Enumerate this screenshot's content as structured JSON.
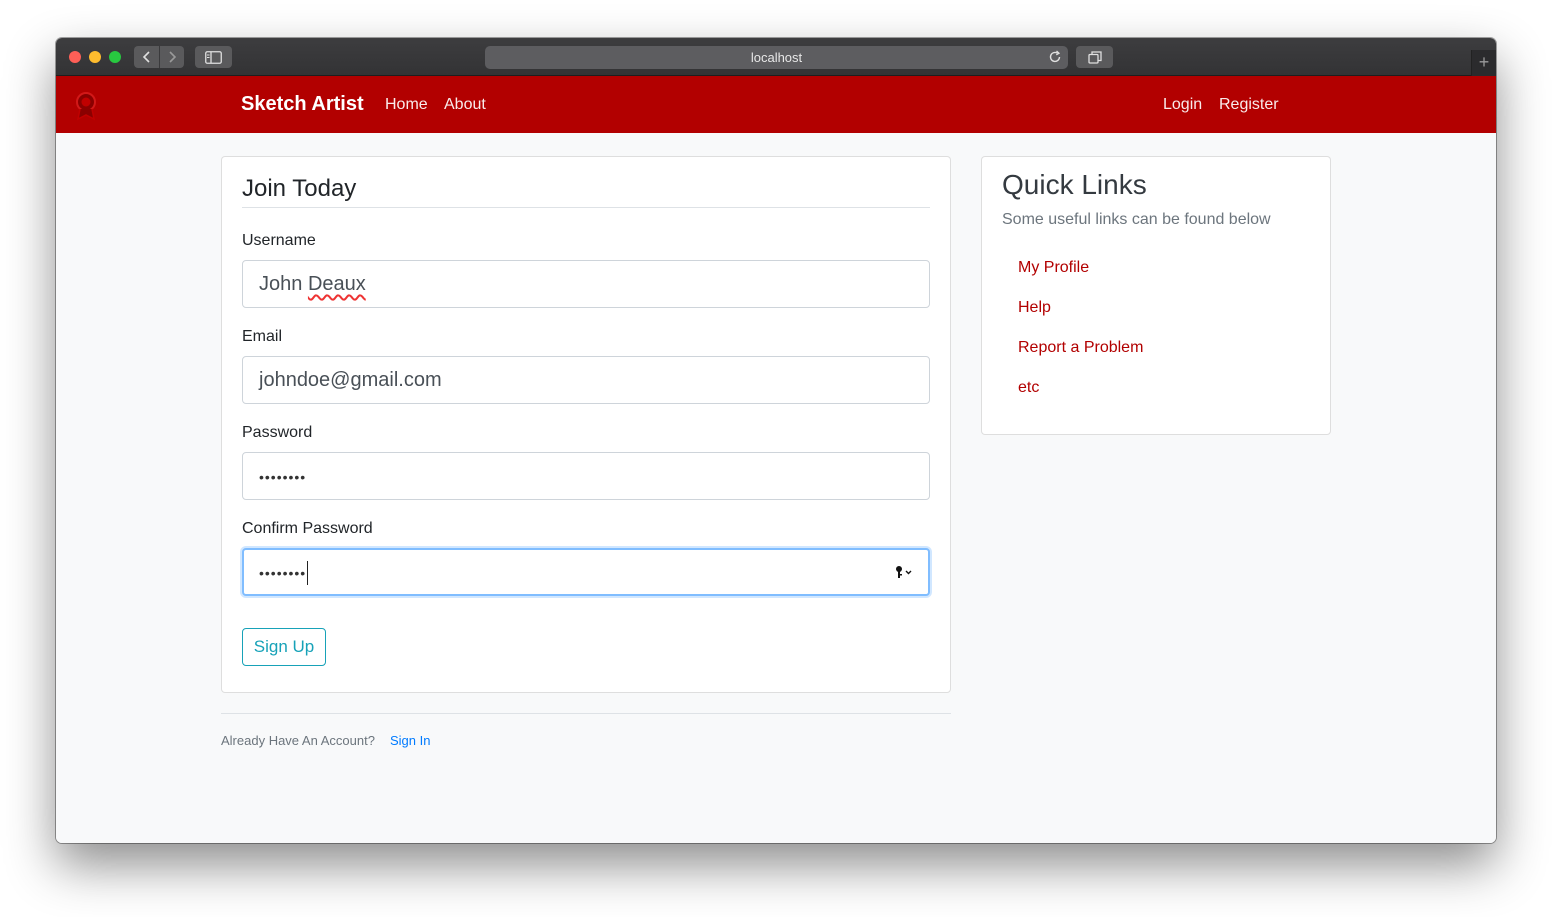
{
  "browser": {
    "url": "localhost",
    "new_tab_label": "+"
  },
  "navbar": {
    "brand": "Sketch Artist",
    "left_links": [
      "Home",
      "About"
    ],
    "right_links": [
      "Login",
      "Register"
    ],
    "color": "#b20000"
  },
  "form": {
    "legend": "Join Today",
    "fields": [
      {
        "label": "Username",
        "value": "John Deaux"
      },
      {
        "label": "Email",
        "value": "johndoe@gmail.com"
      },
      {
        "label": "Password",
        "value": "••••••••"
      },
      {
        "label": "Confirm Password",
        "value": "••••••••"
      }
    ],
    "submit_label": "Sign Up"
  },
  "footer": {
    "prompt": "Already Have An Account?",
    "link": "Sign In"
  },
  "sidebar": {
    "title": "Quick Links",
    "subtitle": "Some useful links can be found below",
    "links": [
      "My Profile",
      "Help",
      "Report a Problem",
      "etc"
    ]
  },
  "icons": {
    "logo": "sketch-logo-icon",
    "back": "chevron-left-icon",
    "forward": "chevron-right-icon",
    "sidebar": "sidebar-icon",
    "reload": "reload-icon",
    "tabs": "tabs-icon",
    "key": "key-icon"
  }
}
